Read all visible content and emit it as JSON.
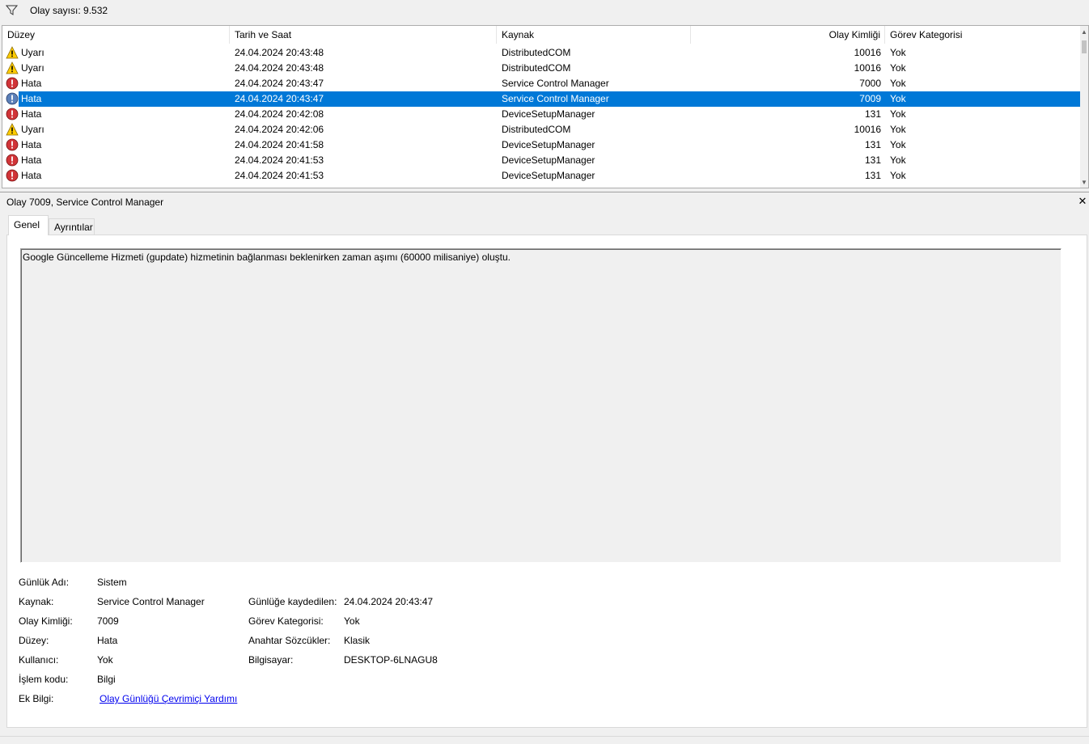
{
  "filter": {
    "icon": "filter-icon",
    "count_text": "Olay sayısı: 9.532"
  },
  "columns": [
    "Düzey",
    "Tarih ve Saat",
    "Kaynak",
    "Olay Kimliği",
    "Görev Kategorisi"
  ],
  "rows": [
    {
      "level": "Uyarı",
      "type": "warning",
      "date": "24.04.2024 20:43:48",
      "source": "DistributedCOM",
      "id": "10016",
      "category": "Yok"
    },
    {
      "level": "Uyarı",
      "type": "warning",
      "date": "24.04.2024 20:43:48",
      "source": "DistributedCOM",
      "id": "10016",
      "category": "Yok"
    },
    {
      "level": "Hata",
      "type": "error",
      "date": "24.04.2024 20:43:47",
      "source": "Service Control Manager",
      "id": "7000",
      "category": "Yok"
    },
    {
      "level": "Hata",
      "type": "error",
      "date": "24.04.2024 20:43:47",
      "source": "Service Control Manager",
      "id": "7009",
      "category": "Yok",
      "selected": true
    },
    {
      "level": "Hata",
      "type": "error",
      "date": "24.04.2024 20:42:08",
      "source": "DeviceSetupManager",
      "id": "131",
      "category": "Yok"
    },
    {
      "level": "Uyarı",
      "type": "warning",
      "date": "24.04.2024 20:42:06",
      "source": "DistributedCOM",
      "id": "10016",
      "category": "Yok"
    },
    {
      "level": "Hata",
      "type": "error",
      "date": "24.04.2024 20:41:58",
      "source": "DeviceSetupManager",
      "id": "131",
      "category": "Yok"
    },
    {
      "level": "Hata",
      "type": "error",
      "date": "24.04.2024 20:41:53",
      "source": "DeviceSetupManager",
      "id": "131",
      "category": "Yok"
    },
    {
      "level": "Hata",
      "type": "error",
      "date": "24.04.2024 20:41:53",
      "source": "DeviceSetupManager",
      "id": "131",
      "category": "Yok"
    }
  ],
  "details": {
    "title": "Olay 7009, Service Control Manager",
    "close_icon": "close-icon",
    "tabs": [
      "Genel",
      "Ayrıntılar"
    ],
    "message": "Google Güncelleme Hizmeti (gupdate) hizmetinin bağlanması beklenirken zaman aşımı (60000 milisaniye) oluştu.",
    "props": {
      "log_name_label": "Günlük Adı:",
      "log_name": "Sistem",
      "source_label": "Kaynak:",
      "source": "Service Control Manager",
      "logged_label": "Günlüğe kaydedilen:",
      "logged": "24.04.2024 20:43:47",
      "event_id_label": "Olay Kimliği:",
      "event_id": "7009",
      "task_cat_label": "Görev Kategorisi:",
      "task_cat": "Yok",
      "level_label": "Düzey:",
      "level": "Hata",
      "keywords_label": "Anahtar Sözcükler:",
      "keywords": "Klasik",
      "user_label": "Kullanıcı:",
      "user": "Yok",
      "computer_label": "Bilgisayar:",
      "computer": "DESKTOP-6LNAGU8",
      "opcode_label": "İşlem kodu:",
      "opcode": "Bilgi",
      "more_info_label": "Ek Bilgi:",
      "more_info_link": "Olay Günlüğü Çevrimiçi Yardımı"
    }
  },
  "colors": {
    "selection": "#0078d7",
    "error": "#d13438",
    "warning": "#ffcc00",
    "link": "#0000ee"
  }
}
